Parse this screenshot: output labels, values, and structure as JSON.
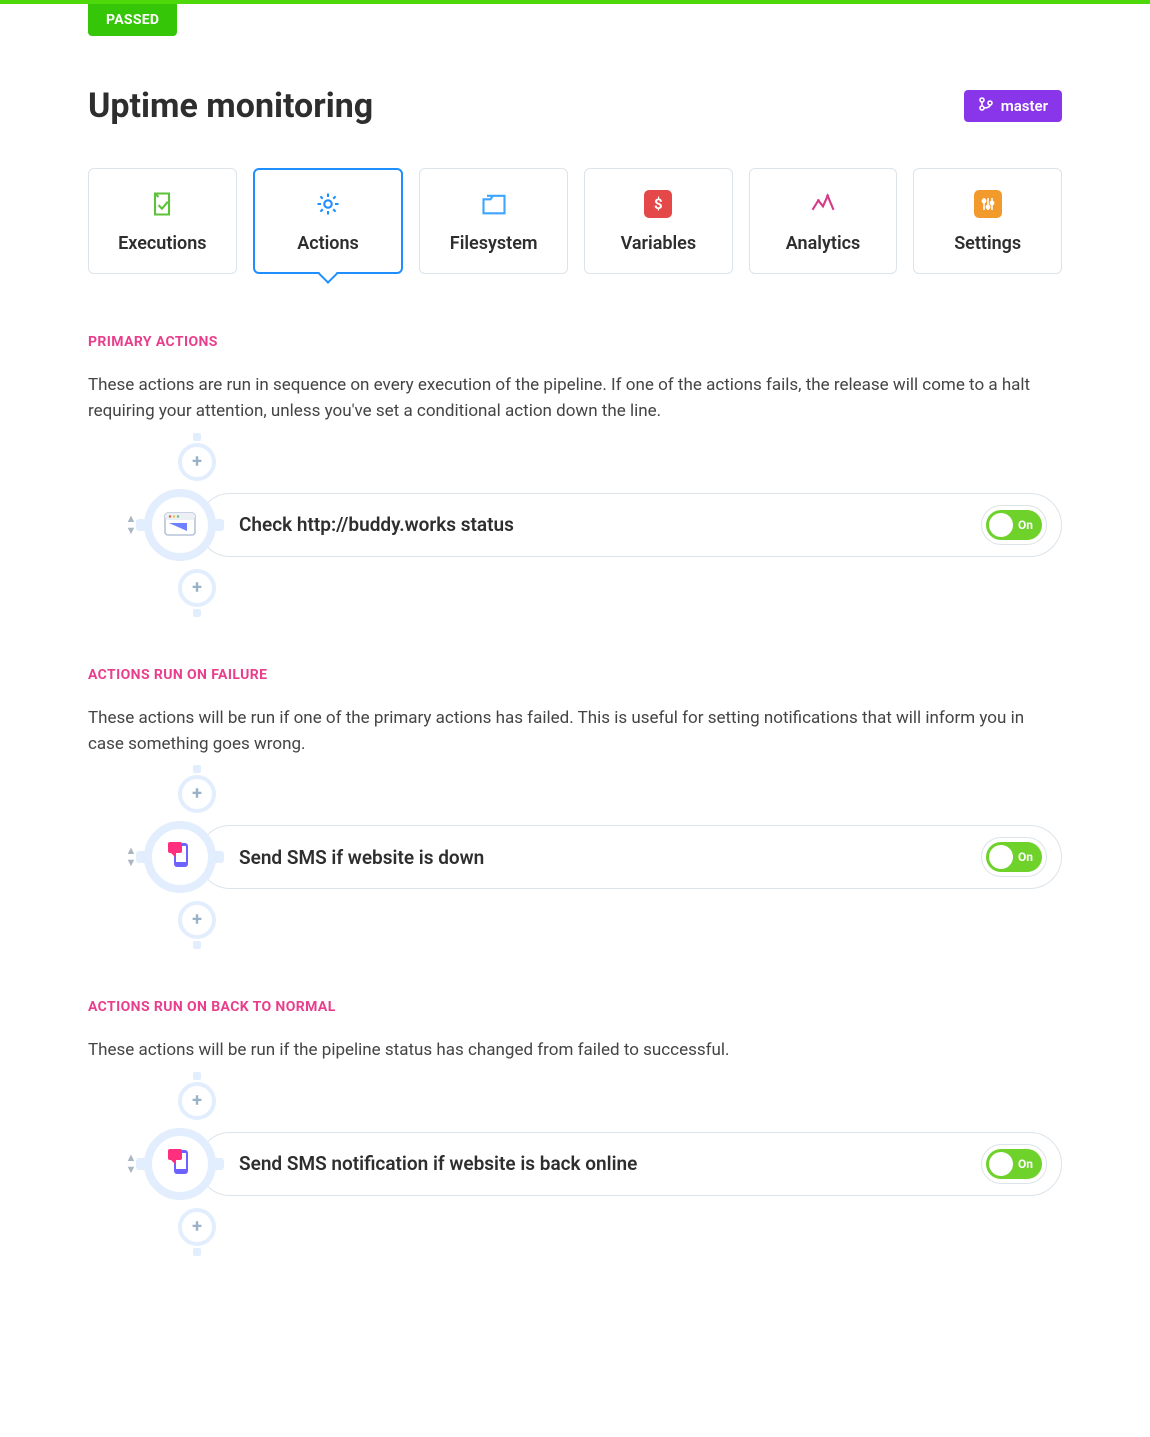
{
  "status_tab": "PASSED",
  "page_title": "Uptime monitoring",
  "branch_label": "master",
  "tabs": [
    {
      "id": "executions",
      "label": "Executions"
    },
    {
      "id": "actions",
      "label": "Actions"
    },
    {
      "id": "filesystem",
      "label": "Filesystem"
    },
    {
      "id": "variables",
      "label": "Variables"
    },
    {
      "id": "analytics",
      "label": "Analytics"
    },
    {
      "id": "settings",
      "label": "Settings"
    }
  ],
  "active_tab": "actions",
  "sections": {
    "primary": {
      "title": "PRIMARY ACTIONS",
      "description": "These actions are run in sequence on every execution of the pipeline. If one of the actions fails, the release will come to a halt requiring your attention, unless you've set a conditional action down the line.",
      "action": {
        "title": "Check http://buddy.works status",
        "toggle_label": "On",
        "enabled": true,
        "icon": "http-request-icon"
      }
    },
    "on_failure": {
      "title": "ACTIONS RUN ON FAILURE",
      "description": "These actions will be run if one of the primary actions has failed. This is useful for setting notifications that will inform you in case something goes wrong.",
      "action": {
        "title": "Send SMS if website is down",
        "toggle_label": "On",
        "enabled": true,
        "icon": "sms-icon"
      }
    },
    "back_normal": {
      "title": "ACTIONS RUN ON BACK TO NORMAL",
      "description": "These actions will be run if the pipeline status has changed from failed to successful.",
      "action": {
        "title": "Send SMS notification if website is back online",
        "toggle_label": "On",
        "enabled": true,
        "icon": "sms-icon"
      }
    }
  },
  "colors": {
    "accent_green": "#35c608",
    "accent_blue": "#1f8fff",
    "accent_purple": "#8935ea",
    "accent_pink": "#e83e8c",
    "toggle_green": "#6ed22a"
  }
}
